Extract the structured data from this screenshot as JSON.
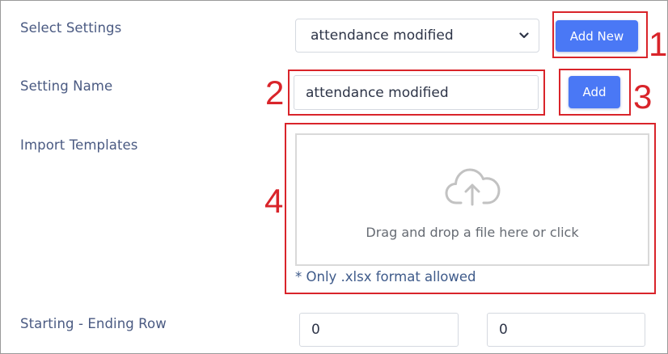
{
  "form": {
    "select_settings_label": "Select Settings",
    "select_settings_value": "attendance modified",
    "add_new_label": "Add New",
    "setting_name_label": "Setting Name",
    "setting_name_value": "attendance modified",
    "add_label": "Add",
    "import_templates_label": "Import Templates",
    "dropzone_text": "Drag and drop a file here or click",
    "format_hint": "* Only .xlsx format allowed",
    "row_range_label": "Starting - Ending Row",
    "starting_row_value": "0",
    "ending_row_value": "0"
  },
  "annotations": {
    "marker_1": "1",
    "marker_2": "2",
    "marker_3": "3",
    "marker_4": "4"
  },
  "colors": {
    "accent": "#4a78f5",
    "annotation": "#d9242a",
    "label": "#4a5a82"
  },
  "icons": {
    "select_arrow": "chevron-down-icon",
    "upload": "cloud-upload-icon"
  }
}
